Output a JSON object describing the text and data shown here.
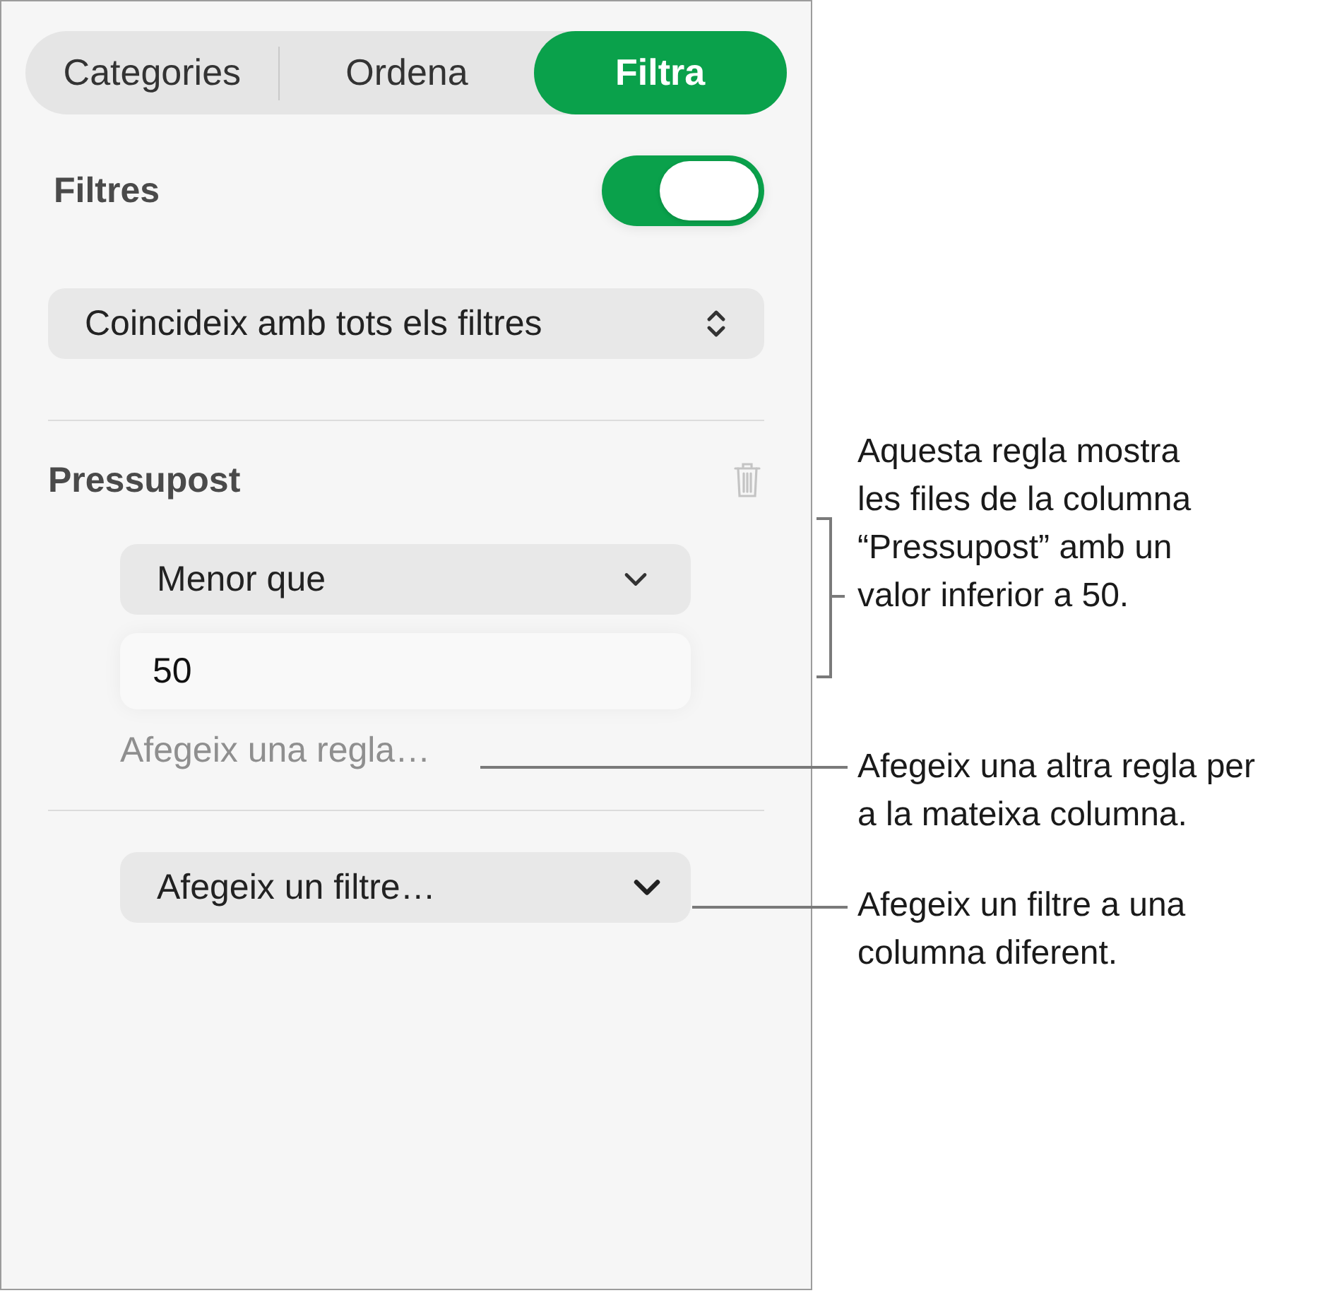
{
  "tabs": [
    {
      "label": "Categories",
      "selected": false
    },
    {
      "label": "Ordena",
      "selected": false
    },
    {
      "label": "Filtra",
      "selected": true
    }
  ],
  "filters_toggle": {
    "label": "Filtres",
    "on": true
  },
  "match_menu": {
    "value": "Coincideix amb tots els filtres"
  },
  "filter": {
    "column": "Pressupost",
    "rule": {
      "condition": "Menor que",
      "value": "50"
    },
    "add_rule": "Afegeix una regla…"
  },
  "add_filter": {
    "label": "Afegeix un filtre…"
  },
  "callouts": [
    {
      "kind": "bracket",
      "lines": [
        "Aquesta regla mostra",
        "les files de la columna",
        "“Pressupost” amb un",
        "valor inferior a 50."
      ]
    },
    {
      "kind": "leader",
      "lines": [
        "Afegeix una altra regla per",
        "a la mateixa columna."
      ]
    },
    {
      "kind": "leader",
      "lines": [
        "Afegeix un filtre a una",
        "columna diferent."
      ]
    }
  ]
}
